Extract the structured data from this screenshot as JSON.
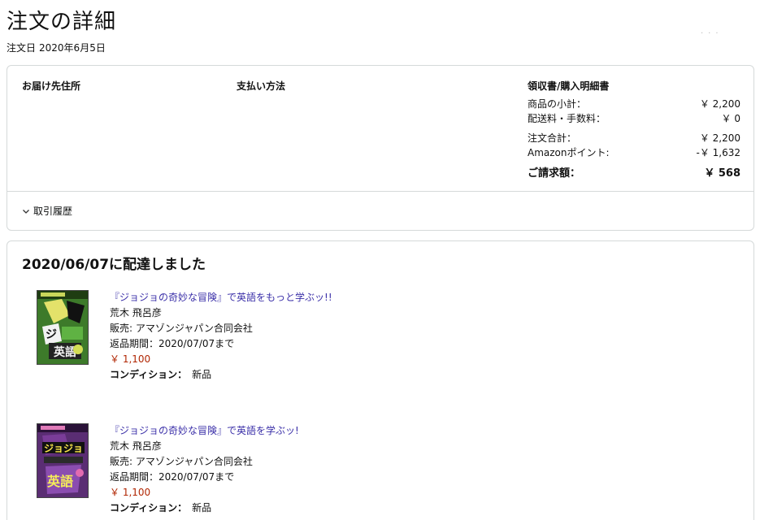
{
  "header": {
    "title": "注文の詳細",
    "order_date_label": "注文日",
    "order_date": "2020年6月5日"
  },
  "summary": {
    "address_title": "お届け先住所",
    "payment_title": "支払い方法",
    "receipt_title": "領収書/購入明細書",
    "rows": [
      {
        "label": "商品の小計：",
        "value": "￥ 2,200"
      },
      {
        "label": "配送料・手数料：",
        "value": "￥ 0"
      },
      {
        "label": "注文合計：",
        "value": "￥ 2,200"
      },
      {
        "label": "Amazonポイント:",
        "value": "-￥ 1,632"
      },
      {
        "label": "ご請求額：",
        "value": "￥ 568"
      }
    ],
    "history_label": "取引履歴"
  },
  "delivery": {
    "title": "2020/06/07に配達しました",
    "items": [
      {
        "title": "『ジョジョの奇妙な冒険』で英語をもっと学ぶッ!!",
        "author": "荒木 飛呂彦",
        "seller": "販売: アマゾンジャパン合同会社",
        "return": "返品期間：2020/07/07まで",
        "price": "￥ 1,100",
        "condition_label": "コンディション：",
        "condition_value": "新品"
      },
      {
        "title": "『ジョジョの奇妙な冒険』で英語を学ぶッ!",
        "author": "荒木 飛呂彦",
        "seller": "販売: アマゾンジャパン合同会社",
        "return": "返品期間：2020/07/07まで",
        "price": "￥ 1,100",
        "condition_label": "コンディション：",
        "condition_value": "新品"
      }
    ]
  },
  "colors": {
    "link": "#3a2fa8",
    "price": "#b12704",
    "border": "#d5d9d9"
  }
}
